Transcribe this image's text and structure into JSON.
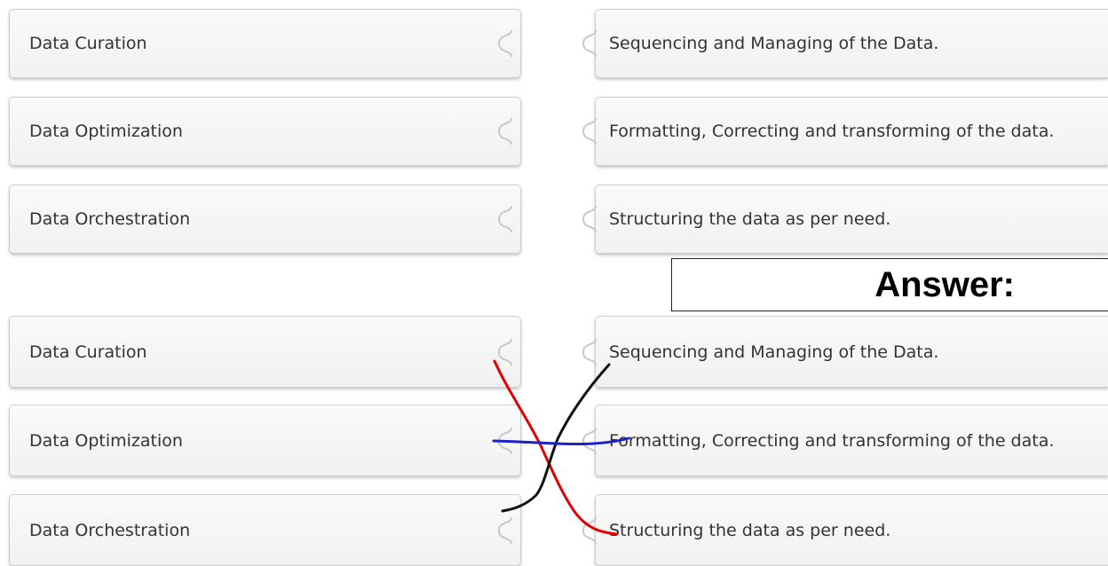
{
  "question": {
    "left_items": [
      "Data Curation",
      "Data Optimization",
      "Data Orchestration"
    ],
    "right_items": [
      "Sequencing and Managing of the Data.",
      "Formatting, Correcting and transforming of the data.",
      "Structuring the data as per need."
    ]
  },
  "answer": {
    "heading": "Answer:",
    "left_items": [
      "Data Curation",
      "Data Optimization",
      "Data Orchestration"
    ],
    "right_items": [
      "Sequencing and Managing of the Data.",
      "Formatting, Correcting and transforming of the data.",
      "Structuring the data as per need."
    ]
  },
  "colors": {
    "line_red": "#e00000",
    "line_black": "#111111",
    "line_blue": "#1a22c8"
  },
  "icons": [
    "puzzle-socket-icon",
    "puzzle-tab-icon"
  ]
}
